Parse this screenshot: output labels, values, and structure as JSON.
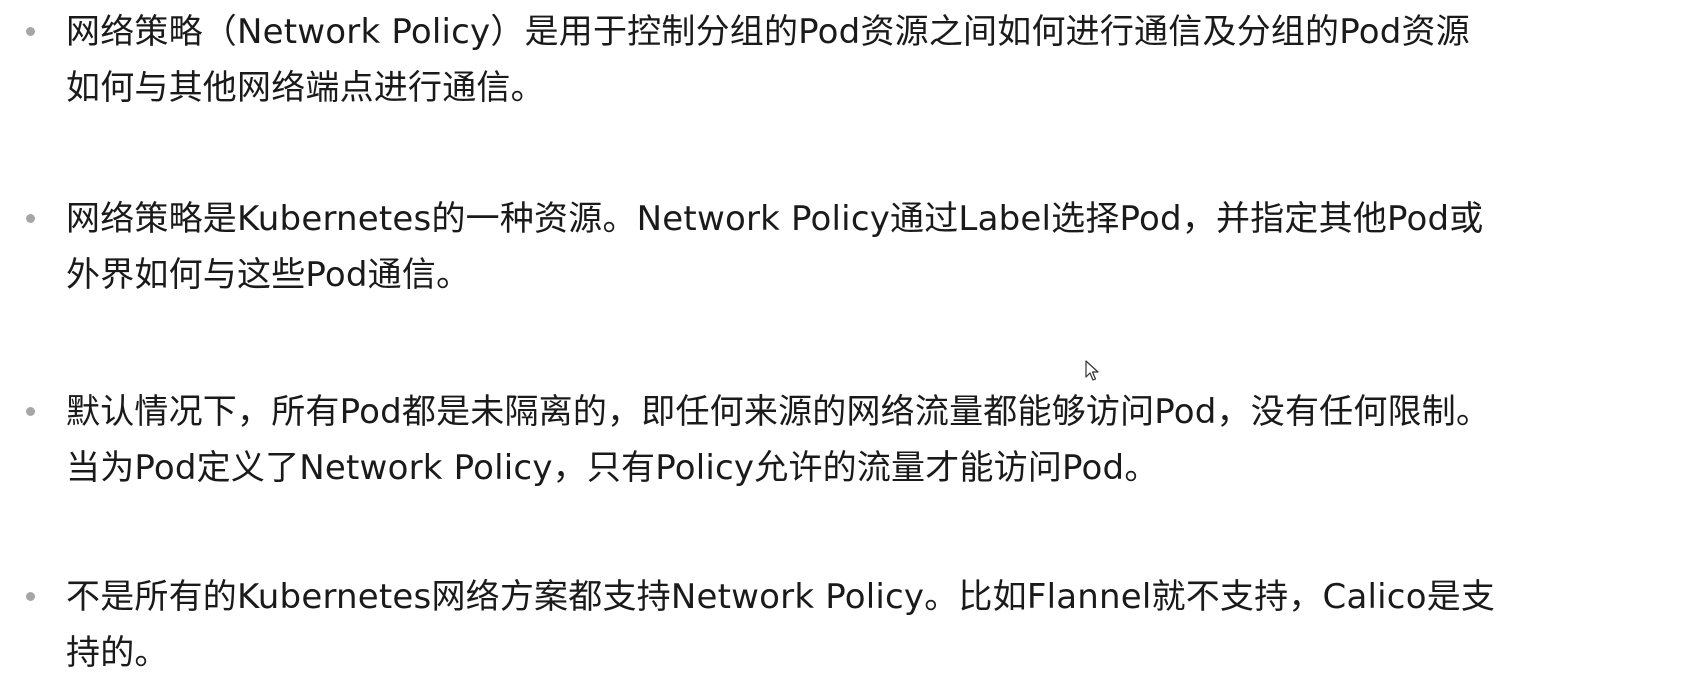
{
  "slide": {
    "bullets": [
      {
        "line1": "网络策略（Network Policy）是用于控制分组的Pod资源之间如何进行通信及分组的Pod资源",
        "line2": "如何与其他网络端点进行通信。"
      },
      {
        "line1": "网络策略是Kubernetes的一种资源。Network Policy通过Label选择Pod，并指定其他Pod或",
        "line2": "外界如何与这些Pod通信。"
      },
      {
        "line1": "默认情况下，所有Pod都是未隔离的，即任何来源的网络流量都能够访问Pod，没有任何限制。",
        "line2": "当为Pod定义了Network Policy，只有Policy允许的流量才能访问Pod。"
      },
      {
        "line1": "不是所有的Kubernetes网络方案都支持Network Policy。比如Flannel就不支持，Calico是支",
        "line2": "持的。"
      }
    ],
    "bullet_color": "#a6a6a6",
    "text_color": "#1a1a1a"
  }
}
